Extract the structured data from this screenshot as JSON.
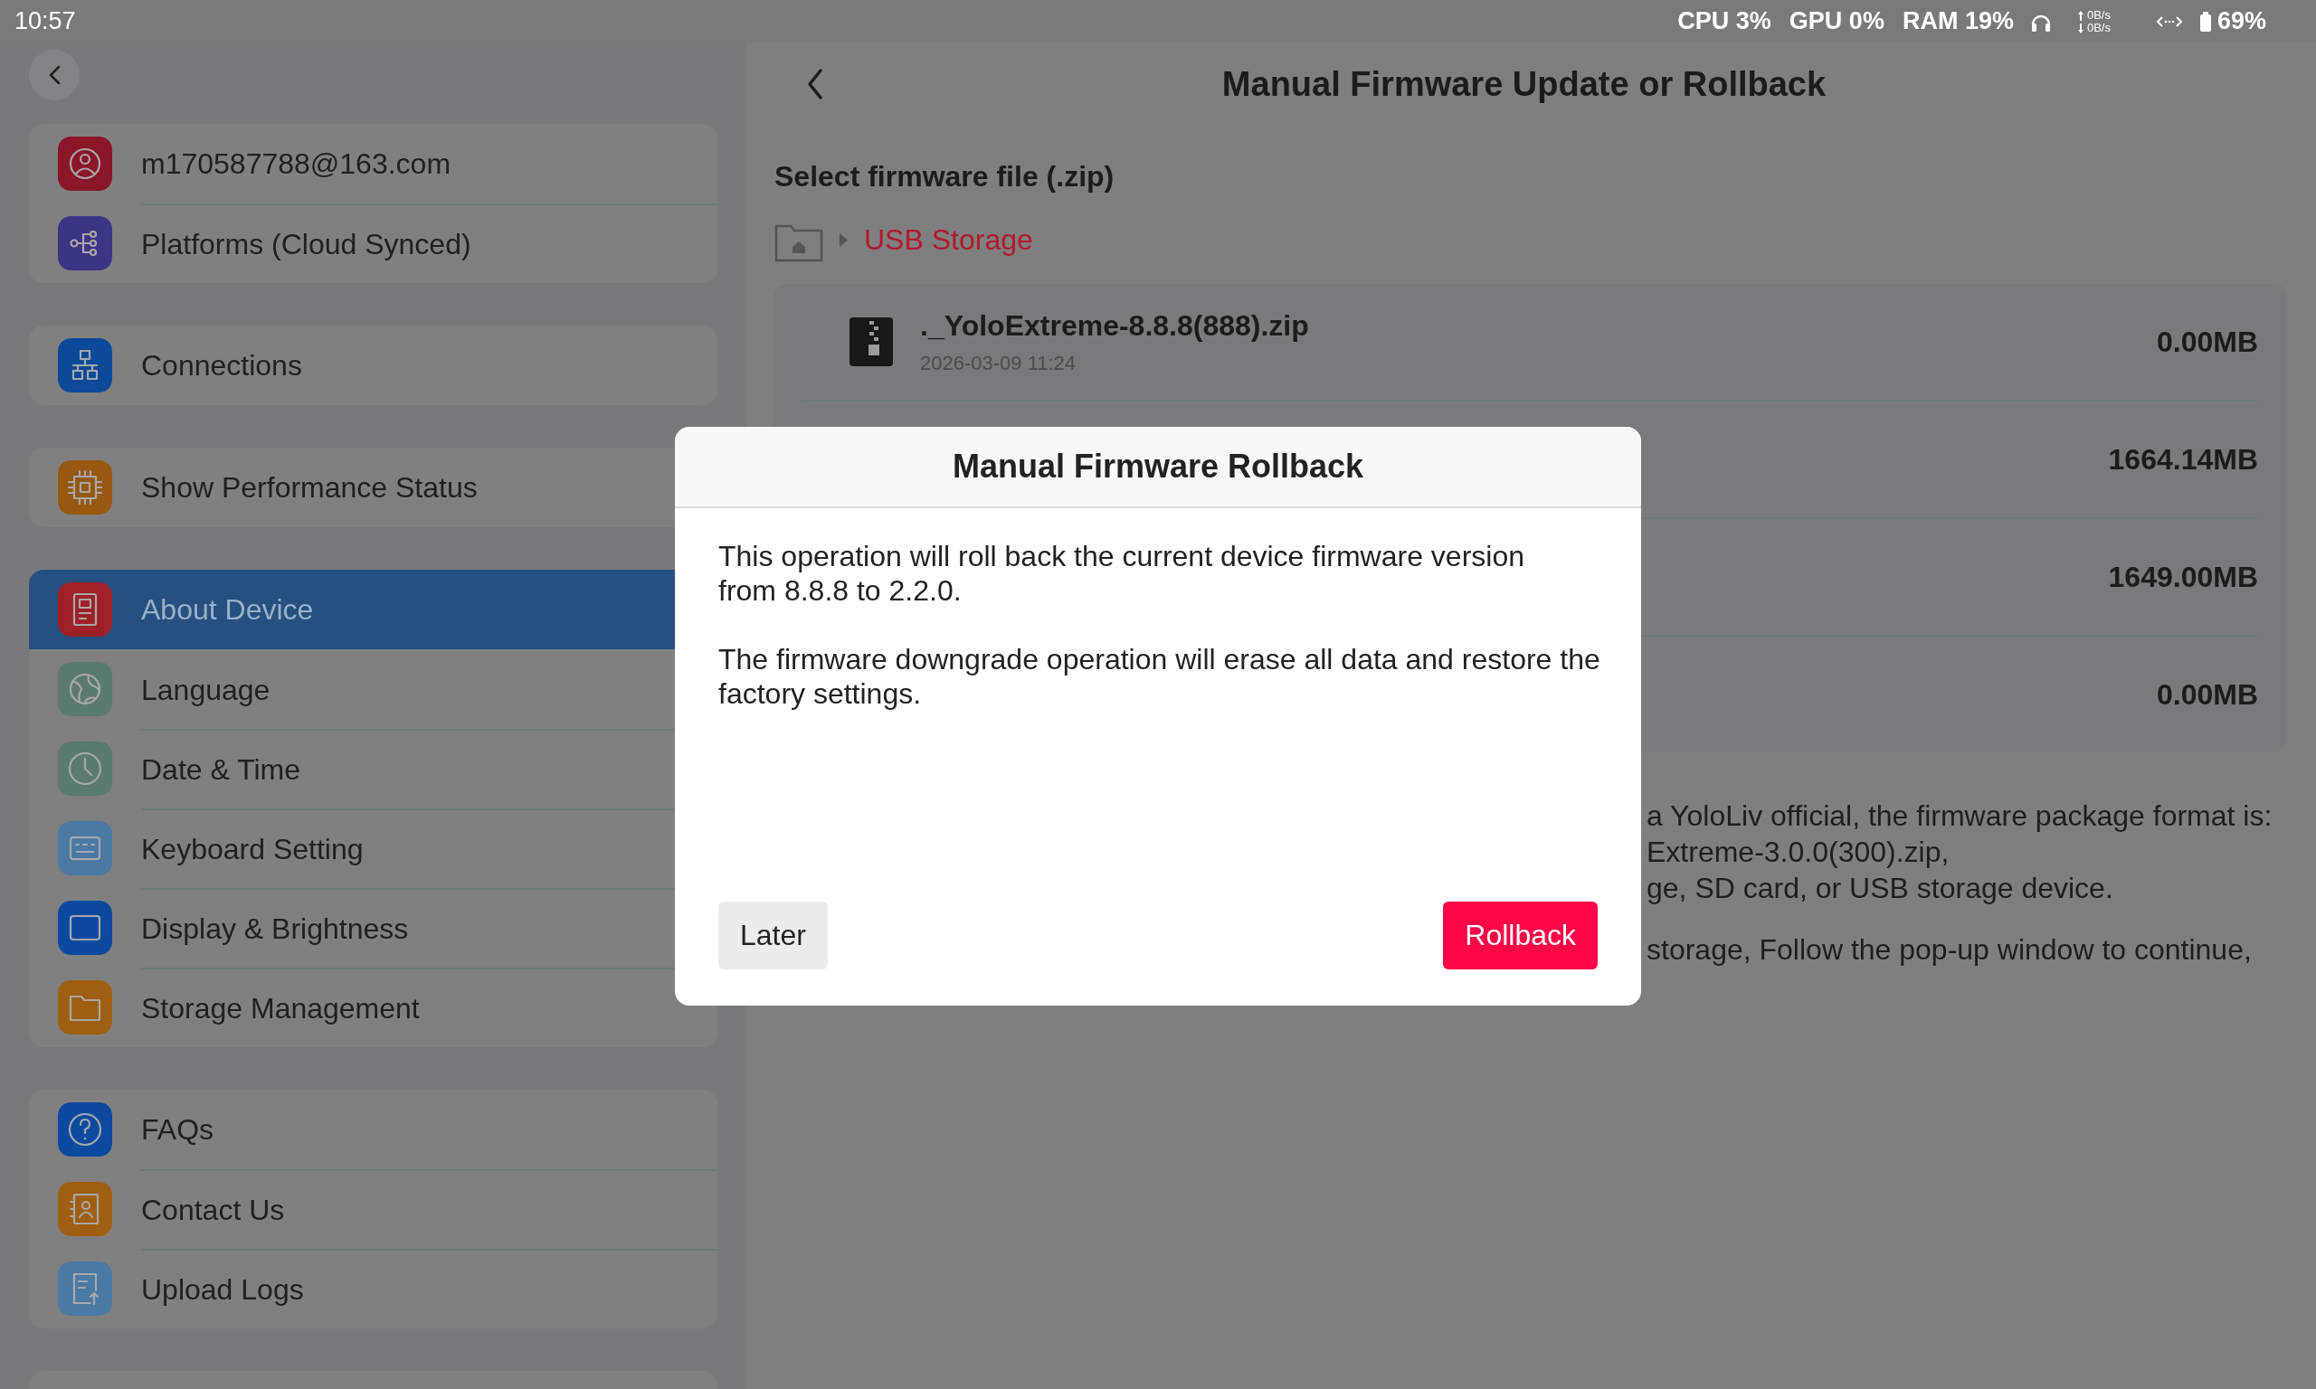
{
  "status_bar": {
    "time": "10:57",
    "cpu": "CPU 3%",
    "gpu": "GPU 0%",
    "ram": "RAM 19%",
    "upload_speed": "0B/s",
    "download_speed": "0B/s",
    "battery": "69%"
  },
  "sidebar": {
    "groups": [
      {
        "items": [
          {
            "label": "m170587788@163.com",
            "color": "#8a1628",
            "selected": false
          },
          {
            "label": "Platforms (Cloud Synced)",
            "color": "#3b3586",
            "selected": false
          }
        ]
      },
      {
        "items": [
          {
            "label": "Connections",
            "color": "#0b4a98",
            "selected": false
          }
        ]
      },
      {
        "items": [
          {
            "label": "Show Performance Status",
            "color": "#985810",
            "selected": false
          }
        ]
      },
      {
        "items": [
          {
            "label": "About Device",
            "color": "#a02028",
            "selected": true
          },
          {
            "label": "Language",
            "color": "#5b7a70",
            "selected": false
          },
          {
            "label": "Date & Time",
            "color": "#5b7a70",
            "selected": false
          },
          {
            "label": "Keyboard Setting",
            "color": "#4a7aa6",
            "selected": false
          },
          {
            "label": "Display & Brightness",
            "color": "#0b4aa0",
            "selected": false
          },
          {
            "label": "Storage Management",
            "color": "#a05e10",
            "selected": false
          }
        ]
      },
      {
        "items": [
          {
            "label": "FAQs",
            "color": "#0b4aa0",
            "selected": false
          },
          {
            "label": "Contact Us",
            "color": "#a05e10",
            "selected": false
          },
          {
            "label": "Upload Logs",
            "color": "#4a7aa6",
            "selected": false
          }
        ]
      }
    ]
  },
  "main": {
    "title": "Manual Firmware Update or Rollback",
    "section_label": "Select firmware file (.zip)",
    "breadcrumb": {
      "location": "USB Storage"
    },
    "files": [
      {
        "name": "._YoloExtreme-8.8.8(888).zip",
        "date": "2026-03-09 11:24",
        "size": "0.00MB"
      },
      {
        "size": "1664.14MB"
      },
      {
        "size": "1649.00MB"
      },
      {
        "size": "0.00MB"
      }
    ],
    "notes": [
      {
        "lines": [
          "a YoloLiv official, the firmware package format is:",
          "Extreme-3.0.0(300).zip,",
          "ge, SD card, or USB storage device."
        ]
      },
      {
        "lines": [
          "storage, Follow the pop-up window to continue,"
        ]
      }
    ]
  },
  "dialog": {
    "title": "Manual Firmware Rollback",
    "paragraphs": [
      "This operation will roll back the current device firmware version from 8.8.8 to 2.2.0.",
      "The firmware downgrade operation will erase all data and restore the factory settings."
    ],
    "buttons": [
      {
        "label": "Later",
        "kind": "secondary"
      },
      {
        "label": "Rollback",
        "kind": "primary"
      }
    ]
  }
}
